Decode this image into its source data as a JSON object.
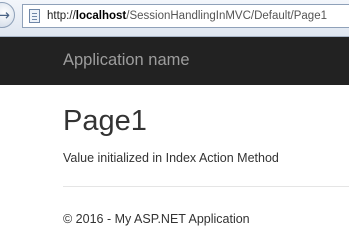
{
  "browser": {
    "url_scheme": "http://",
    "url_host": "localhost",
    "url_path": "/SessionHandlingInMVC/Default/Page1",
    "back_icon": "back-arrow-icon",
    "page_icon": "page-icon"
  },
  "navbar": {
    "brand": "Application name"
  },
  "main": {
    "title": "Page1",
    "message": "Value initialized in Index Action Method"
  },
  "footer": {
    "text": "© 2016 - My ASP.NET Application"
  },
  "colors": {
    "navbar_bg": "#222222",
    "brand_text": "#9d9d9d",
    "body_text": "#333333"
  }
}
